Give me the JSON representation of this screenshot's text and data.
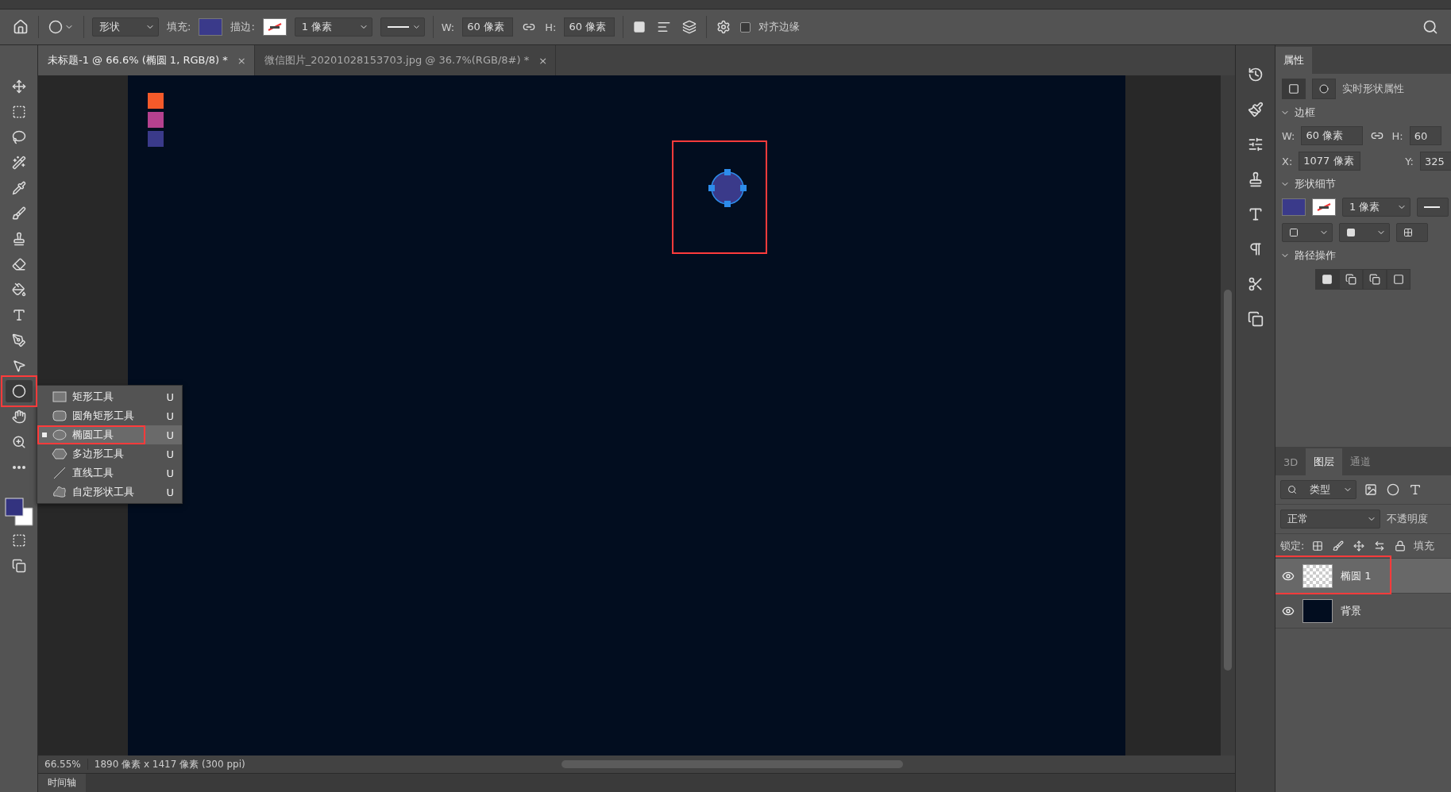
{
  "options_bar": {
    "shape_mode": "形状",
    "fill_label": "填充:",
    "stroke_label": "描边:",
    "stroke_width": "1 像素",
    "w_label": "W:",
    "w_value": "60 像素",
    "h_label": "H:",
    "h_value": "60 像素",
    "align_edges": {
      "label": "对齐边缘",
      "checked": false
    }
  },
  "tabs": [
    {
      "label": "未标题-1 @ 66.6% (椭圆 1, RGB/8) *",
      "close": "×",
      "selected": true
    },
    {
      "label": "微信图片_20201028153703.jpg @ 36.7%(RGB/8#) *",
      "close": "×",
      "selected": false
    }
  ],
  "tools": [
    {
      "kind": "move",
      "selected": false
    },
    {
      "kind": "marquee",
      "selected": false
    },
    {
      "kind": "lasso",
      "selected": false
    },
    {
      "kind": "quick_select",
      "selected": false
    },
    {
      "kind": "eyedropper",
      "selected": false
    },
    {
      "kind": "brush",
      "selected": false
    },
    {
      "kind": "stamp",
      "selected": false
    },
    {
      "kind": "eraser",
      "selected": false
    },
    {
      "kind": "bucket",
      "selected": false
    },
    {
      "kind": "type",
      "selected": false
    },
    {
      "kind": "pen",
      "selected": false
    },
    {
      "kind": "pointer",
      "selected": false
    },
    {
      "kind": "ellipse",
      "selected": true
    },
    {
      "kind": "hand",
      "selected": false
    },
    {
      "kind": "zoom",
      "selected": false
    },
    {
      "kind": "more",
      "selected": false
    }
  ],
  "canvas": {
    "swatches": [
      {
        "color": "#f45a2a"
      },
      {
        "color": "#b5418f"
      },
      {
        "color": "#3a3a8a"
      }
    ]
  },
  "shape_menu": [
    {
      "kind": "rect",
      "label": "矩形工具",
      "shortcut": "U",
      "selected": false
    },
    {
      "kind": "round_rect",
      "label": "圆角矩形工具",
      "shortcut": "U",
      "selected": false
    },
    {
      "kind": "ellipse",
      "label": "椭圆工具",
      "shortcut": "U",
      "selected": true
    },
    {
      "kind": "polygon",
      "label": "多边形工具",
      "shortcut": "U",
      "selected": false
    },
    {
      "kind": "line",
      "label": "直线工具",
      "shortcut": "U",
      "selected": false
    },
    {
      "kind": "custom",
      "label": "自定形状工具",
      "shortcut": "U",
      "selected": false
    }
  ],
  "properties": {
    "tab": "属性",
    "title": "实时形状属性",
    "bounds_title": "边框",
    "w_label": "W:",
    "w_value": "60 像素",
    "h_label": "H:",
    "h_value": "60",
    "x_label": "X:",
    "x_value": "1077 像素",
    "y_label": "Y:",
    "y_value": "325",
    "details_title": "形状细节",
    "stroke_width": "1 像素",
    "path_ops_title": "路径操作"
  },
  "layers_panel": {
    "tabs": [
      {
        "label": "3D",
        "selected": false
      },
      {
        "label": "图层",
        "selected": true
      },
      {
        "label": "通道",
        "selected": false
      }
    ],
    "filter": "类型",
    "blend_mode": "正常",
    "opacity_label": "不透明度",
    "lock_label": "锁定:",
    "fill_label": "填充",
    "layers": [
      {
        "name": "椭圆 1",
        "kind": "shape",
        "selected": true,
        "visible": true
      },
      {
        "name": "背景",
        "kind": "background",
        "selected": false,
        "visible": true
      }
    ]
  },
  "status_bar": {
    "zoom": "66.55%",
    "doc_info": "1890 像素 x 1417 像素 (300 ppi)"
  },
  "timeline": {
    "label": "时间轴"
  }
}
